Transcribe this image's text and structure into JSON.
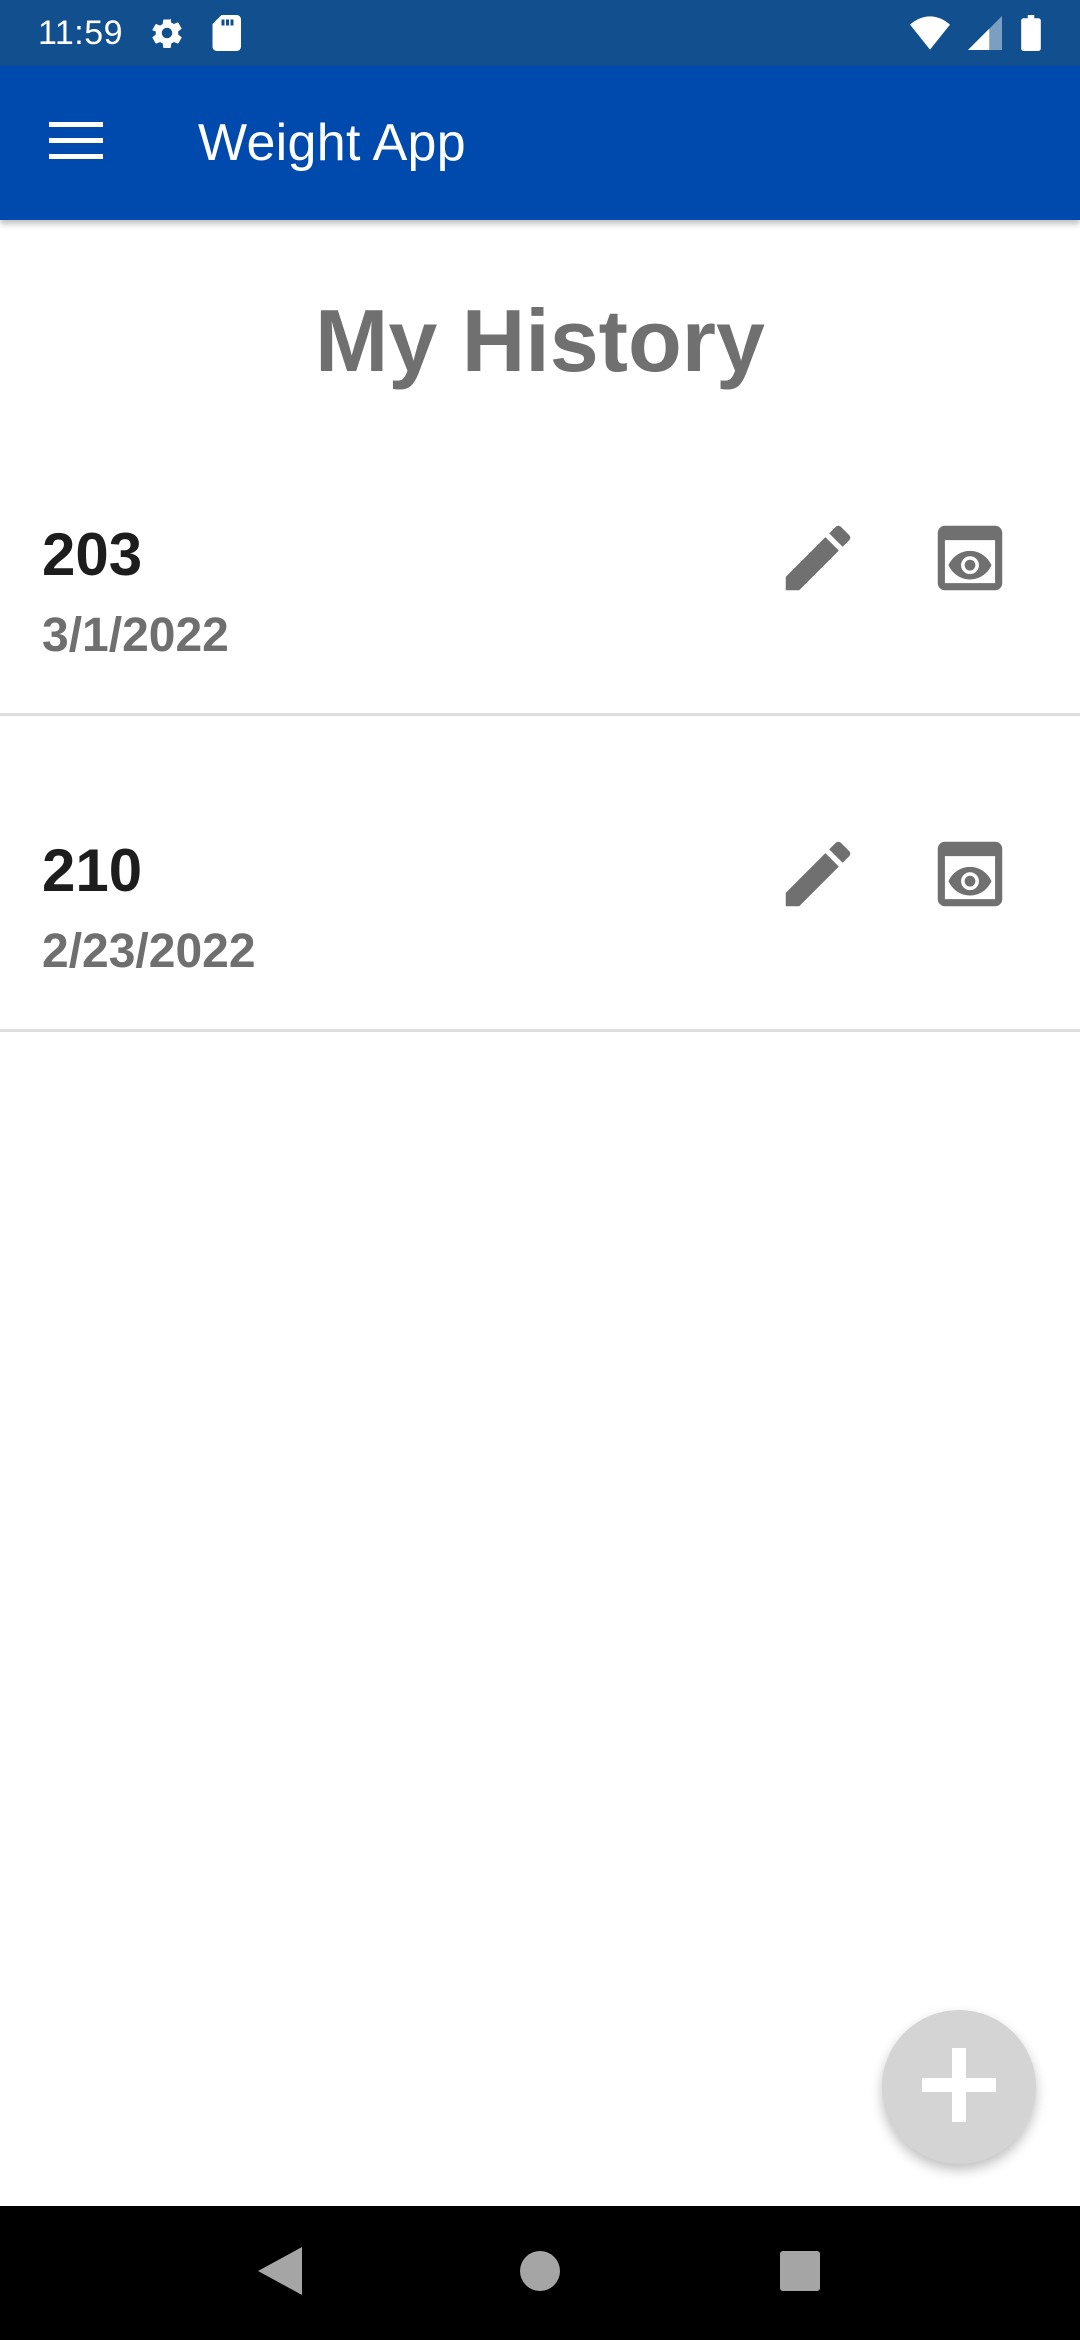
{
  "status_bar": {
    "time": "11:59",
    "icons": [
      "gear-icon",
      "sd-card-icon",
      "wifi-icon",
      "signal-icon",
      "battery-icon"
    ]
  },
  "app_bar": {
    "title": "Weight App",
    "menu_icon": "hamburger-menu-icon",
    "color": "#014aad"
  },
  "page": {
    "title": "My History"
  },
  "history": [
    {
      "weight": "203",
      "date": "3/1/2022",
      "edit_icon": "pencil-icon",
      "view_icon": "eye-icon"
    },
    {
      "weight": "210",
      "date": "2/23/2022",
      "edit_icon": "pencil-icon",
      "view_icon": "eye-icon"
    }
  ],
  "fab": {
    "icon": "plus-icon",
    "color": "#d4d4d4"
  },
  "nav_bar": {
    "buttons": [
      "back-icon",
      "home-icon",
      "recents-icon"
    ]
  },
  "colors": {
    "status_bar": "#114f8f",
    "icon_gray": "#707070",
    "divider": "#dedede"
  }
}
